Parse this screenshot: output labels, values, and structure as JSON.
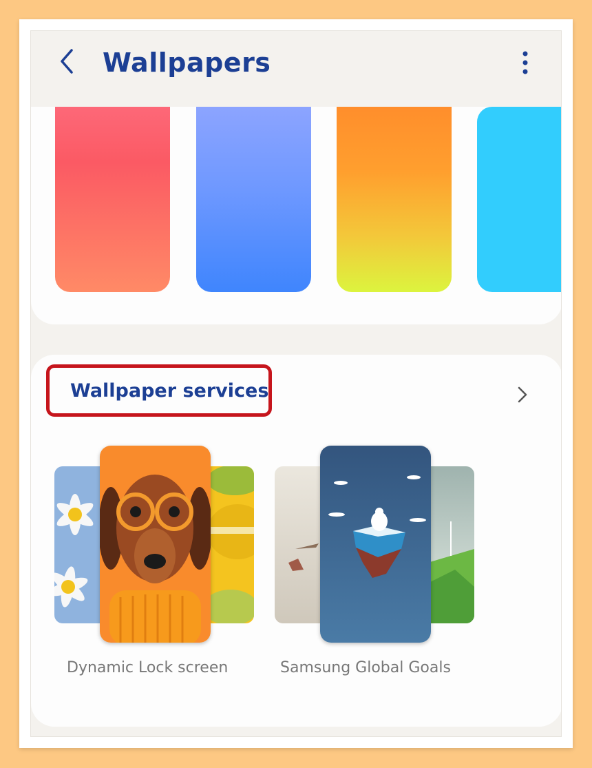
{
  "header": {
    "title": "Wallpapers",
    "back_icon": "chevron-left-icon",
    "more_icon": "more-vertical-icon"
  },
  "wallpaper_strip": {
    "swatches": [
      {
        "name": "coral-gradient",
        "colors": [
          "#fd6878",
          "#ff8a66"
        ]
      },
      {
        "name": "blue-gradient",
        "colors": [
          "#8ca4ff",
          "#3f85fd"
        ]
      },
      {
        "name": "orange-yellow-gradient",
        "colors": [
          "#ff8e2c",
          "#dcf43e"
        ]
      },
      {
        "name": "cyan",
        "colors": [
          "#32cdfd"
        ]
      }
    ]
  },
  "services": {
    "title": "Wallpaper services",
    "chevron_icon": "chevron-right-icon",
    "highlight_color": "#c6151c",
    "items": [
      {
        "label": "Dynamic Lock screen"
      },
      {
        "label": "Samsung Global Goals"
      }
    ]
  },
  "colors": {
    "accent": "#1c3f94",
    "background": "#f4f2ee",
    "outer": "#fdc883"
  }
}
